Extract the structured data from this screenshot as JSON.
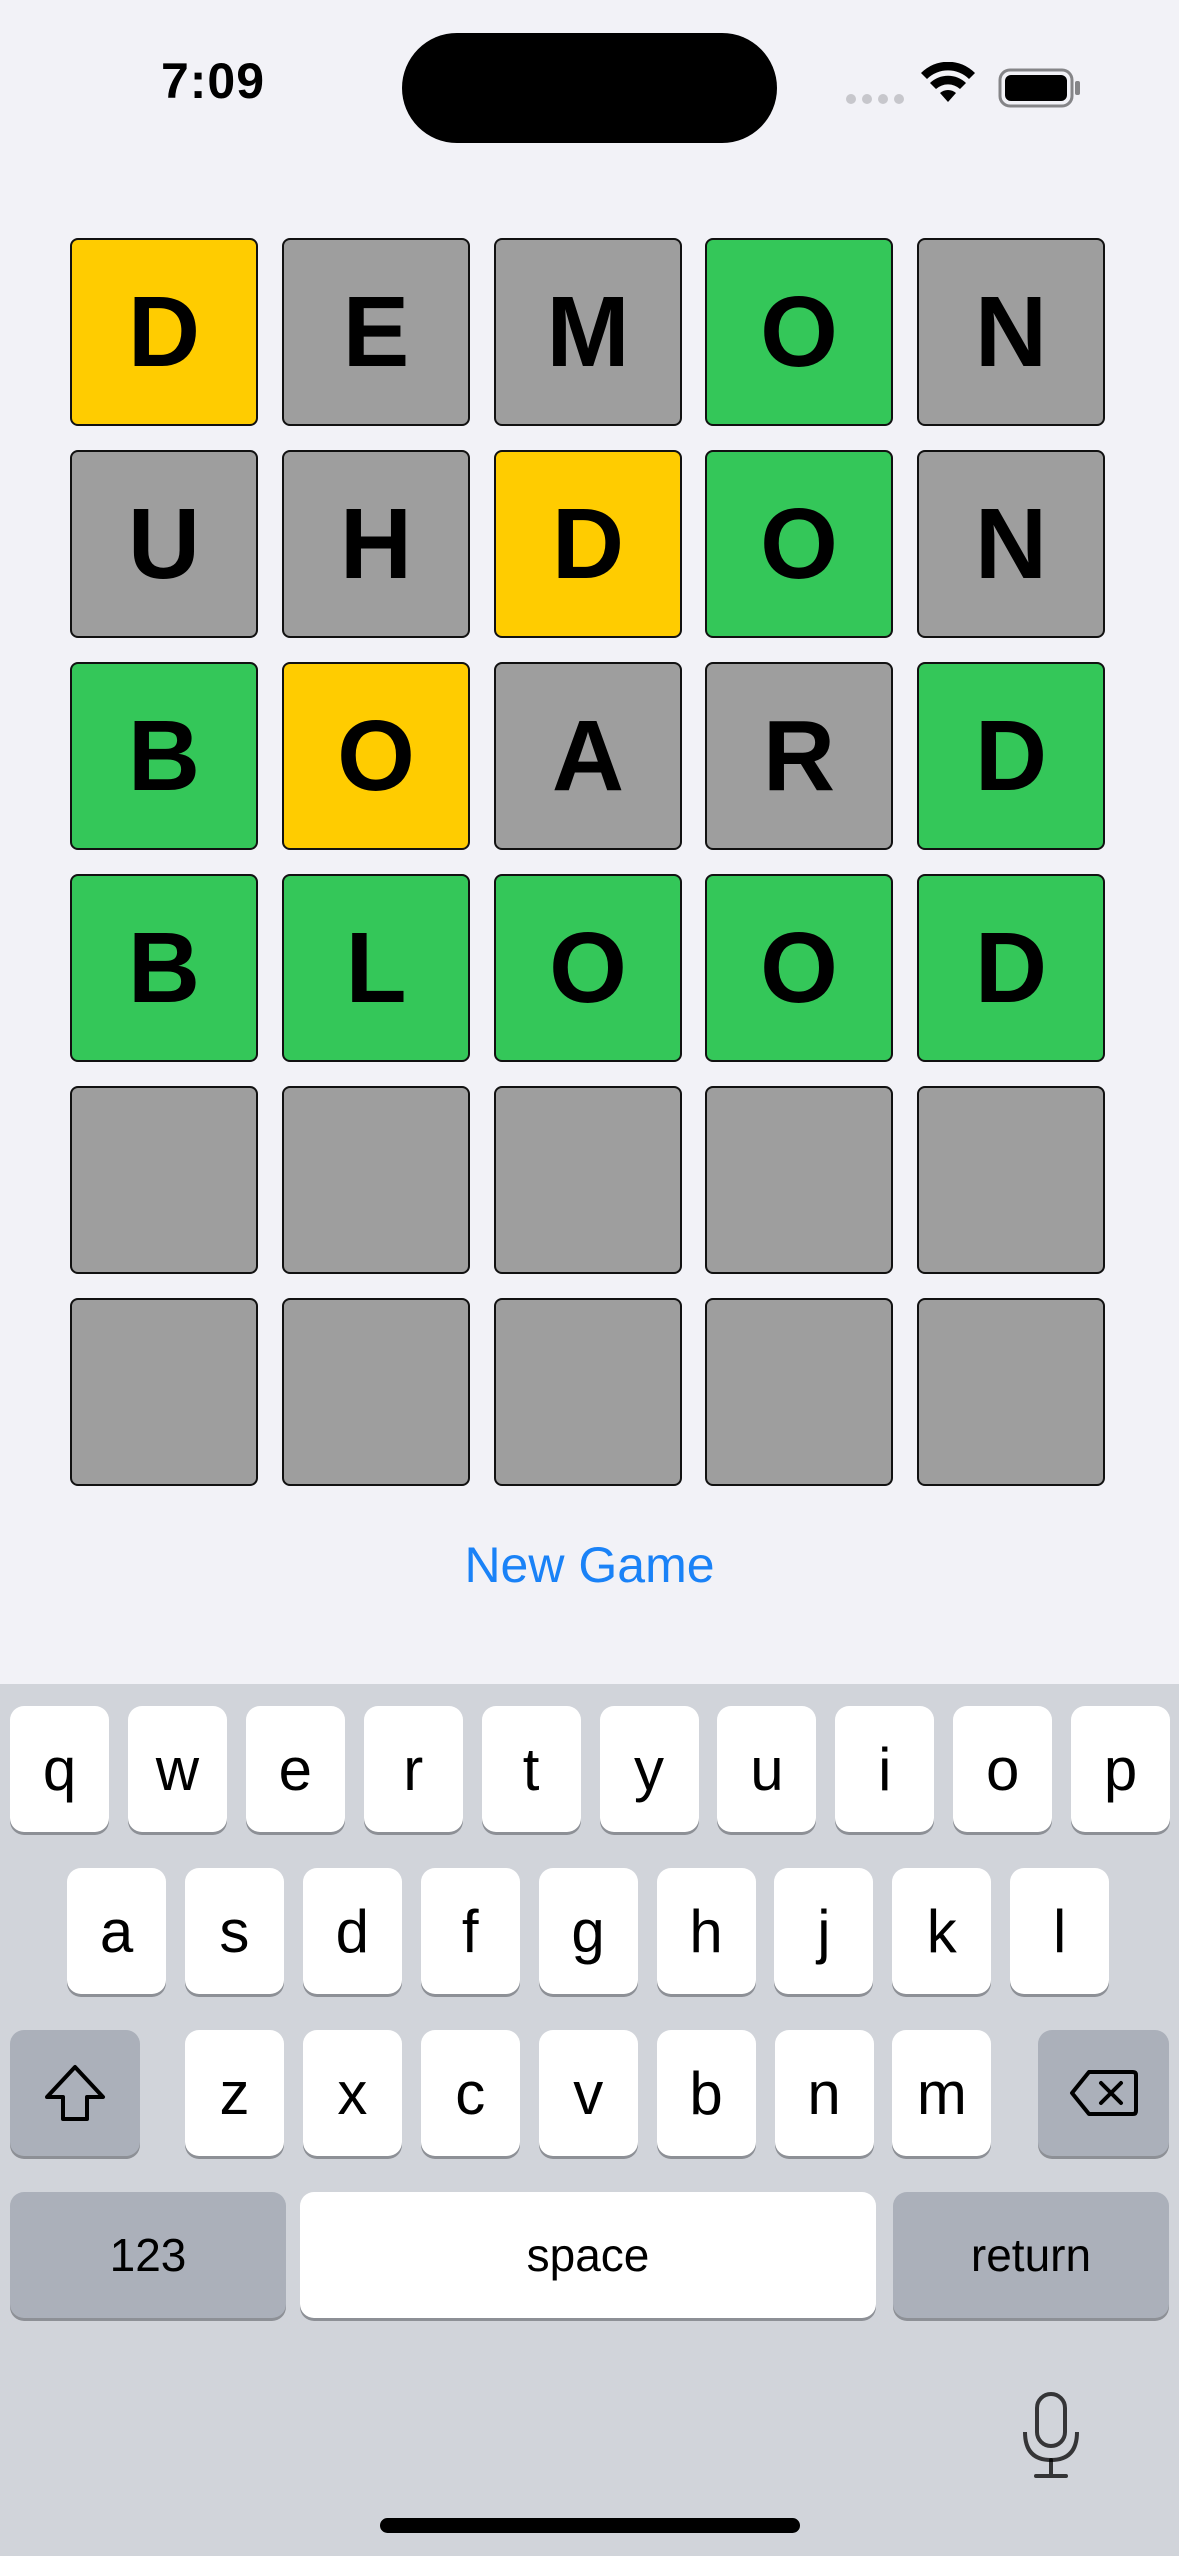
{
  "status_bar": {
    "time": "7:09",
    "icons": [
      "cellular-signal-icon",
      "wifi-icon",
      "battery-icon"
    ]
  },
  "board": {
    "colors": {
      "green": "#34c759",
      "yellow": "#ffcc00",
      "gray": "#9e9e9e"
    },
    "rows": [
      [
        {
          "letter": "D",
          "state": "yellow"
        },
        {
          "letter": "E",
          "state": "gray"
        },
        {
          "letter": "M",
          "state": "gray"
        },
        {
          "letter": "O",
          "state": "green"
        },
        {
          "letter": "N",
          "state": "gray"
        }
      ],
      [
        {
          "letter": "U",
          "state": "gray"
        },
        {
          "letter": "H",
          "state": "gray"
        },
        {
          "letter": "D",
          "state": "yellow"
        },
        {
          "letter": "O",
          "state": "green"
        },
        {
          "letter": "N",
          "state": "gray"
        }
      ],
      [
        {
          "letter": "B",
          "state": "green"
        },
        {
          "letter": "O",
          "state": "yellow"
        },
        {
          "letter": "A",
          "state": "gray"
        },
        {
          "letter": "R",
          "state": "gray"
        },
        {
          "letter": "D",
          "state": "green"
        }
      ],
      [
        {
          "letter": "B",
          "state": "green"
        },
        {
          "letter": "L",
          "state": "green"
        },
        {
          "letter": "O",
          "state": "green"
        },
        {
          "letter": "O",
          "state": "green"
        },
        {
          "letter": "D",
          "state": "green"
        }
      ],
      [
        {
          "letter": "",
          "state": "gray"
        },
        {
          "letter": "",
          "state": "gray"
        },
        {
          "letter": "",
          "state": "gray"
        },
        {
          "letter": "",
          "state": "gray"
        },
        {
          "letter": "",
          "state": "gray"
        }
      ],
      [
        {
          "letter": "",
          "state": "gray"
        },
        {
          "letter": "",
          "state": "gray"
        },
        {
          "letter": "",
          "state": "gray"
        },
        {
          "letter": "",
          "state": "gray"
        },
        {
          "letter": "",
          "state": "gray"
        }
      ]
    ]
  },
  "new_game_label": "New Game",
  "keyboard": {
    "row1": [
      "q",
      "w",
      "e",
      "r",
      "t",
      "y",
      "u",
      "i",
      "o",
      "p"
    ],
    "row2": [
      "a",
      "s",
      "d",
      "f",
      "g",
      "h",
      "j",
      "k",
      "l"
    ],
    "row3": [
      "z",
      "x",
      "c",
      "v",
      "b",
      "n",
      "m"
    ],
    "shift_icon": "shift-icon",
    "delete_icon": "delete-icon",
    "numbers_label": "123",
    "space_label": "space",
    "return_label": "return",
    "mic_icon": "microphone-icon"
  }
}
